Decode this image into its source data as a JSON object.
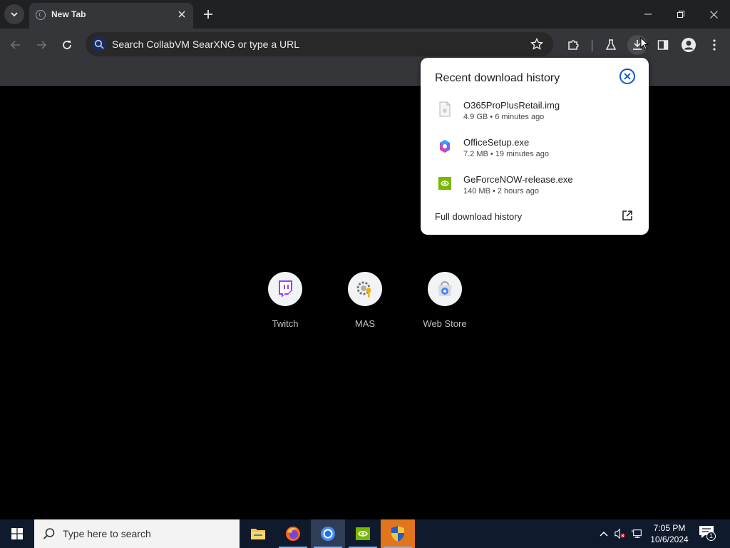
{
  "browser": {
    "tab": {
      "title": "New Tab"
    },
    "omnibox": {
      "placeholder": "Search CollabVM SearXNG or type a URL"
    }
  },
  "shortcuts": [
    {
      "label": "Twitch",
      "icon": "twitch-icon"
    },
    {
      "label": "MAS",
      "icon": "gear-key-icon"
    },
    {
      "label": "Web Store",
      "icon": "web-store-icon"
    }
  ],
  "download_bubble": {
    "title": "Recent download history",
    "items": [
      {
        "name": "O365ProPlusRetail.img",
        "meta": "4.9 GB • 6 minutes ago",
        "icon": "disk-image-file-icon"
      },
      {
        "name": "OfficeSetup.exe",
        "meta": "7.2 MB • 19 minutes ago",
        "icon": "office-icon"
      },
      {
        "name": "GeForceNOW-release.exe",
        "meta": "140 MB • 2 hours ago",
        "icon": "nvidia-icon"
      }
    ],
    "footer_label": "Full download history"
  },
  "taskbar": {
    "search_placeholder": "Type here to search",
    "apps": [
      "file-explorer-icon",
      "firefox-icon",
      "chrome-icon",
      "nvidia-icon",
      "shield-icon"
    ],
    "clock": {
      "time": "7:05 PM",
      "date": "10/6/2024"
    },
    "notification_count": "1"
  },
  "colors": {
    "accent": "#0b57d0",
    "toolbar": "#35363a",
    "tabstrip": "#202124",
    "twitch": "#9146ff",
    "nvidia": "#76b900"
  }
}
